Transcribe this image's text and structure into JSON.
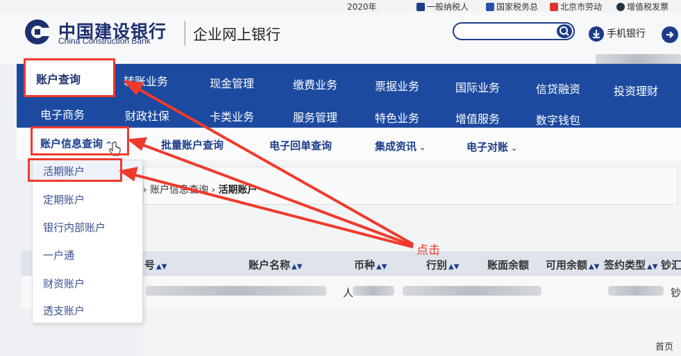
{
  "top_strip": {
    "items": [
      "2020年",
      "一般纳税人",
      "国家税务总",
      "北京市劳动",
      "增值税发票"
    ]
  },
  "header": {
    "brand_cn": "中国建设银行",
    "brand_en": "China Construction Bank",
    "subtitle": "企业网上银行",
    "search_placeholder": "",
    "mobile_bank": "手机银行"
  },
  "nav": {
    "active": "账户查询",
    "row1": [
      "转账业务",
      "现金管理",
      "缴费业务",
      "票据业务",
      "国际业务",
      "信贷融资",
      "投资理财"
    ],
    "row2": [
      "电子商务",
      "财政社保",
      "卡类业务",
      "服务管理",
      "特色业务",
      "增值服务",
      "数字钱包"
    ]
  },
  "subnav": {
    "items": [
      "账户信息查询",
      "批量账户查询",
      "电子回单查询",
      "集成资讯",
      "电子对账"
    ]
  },
  "dropdown": {
    "items": [
      "活期账户",
      "定期账户",
      "银行内部账户",
      "一户通",
      "财资账户",
      "透支账户"
    ]
  },
  "breadcrumb": {
    "parent": "账户信息查询",
    "current": "活期账户"
  },
  "table": {
    "headers": [
      "号",
      "账户名称",
      "币种",
      "行别",
      "账面余额",
      "可用余额",
      "签约类型",
      "钞汇"
    ],
    "row_visible": [
      "人",
      "钞"
    ]
  },
  "pagination": {
    "first": "首页"
  },
  "annotation": {
    "label": "点击",
    "color": "#f03a2c"
  },
  "colors": {
    "nav_blue": "#1c4aa0",
    "brand_dark": "#1d2f6e",
    "accent_red": "#f03a2c"
  }
}
